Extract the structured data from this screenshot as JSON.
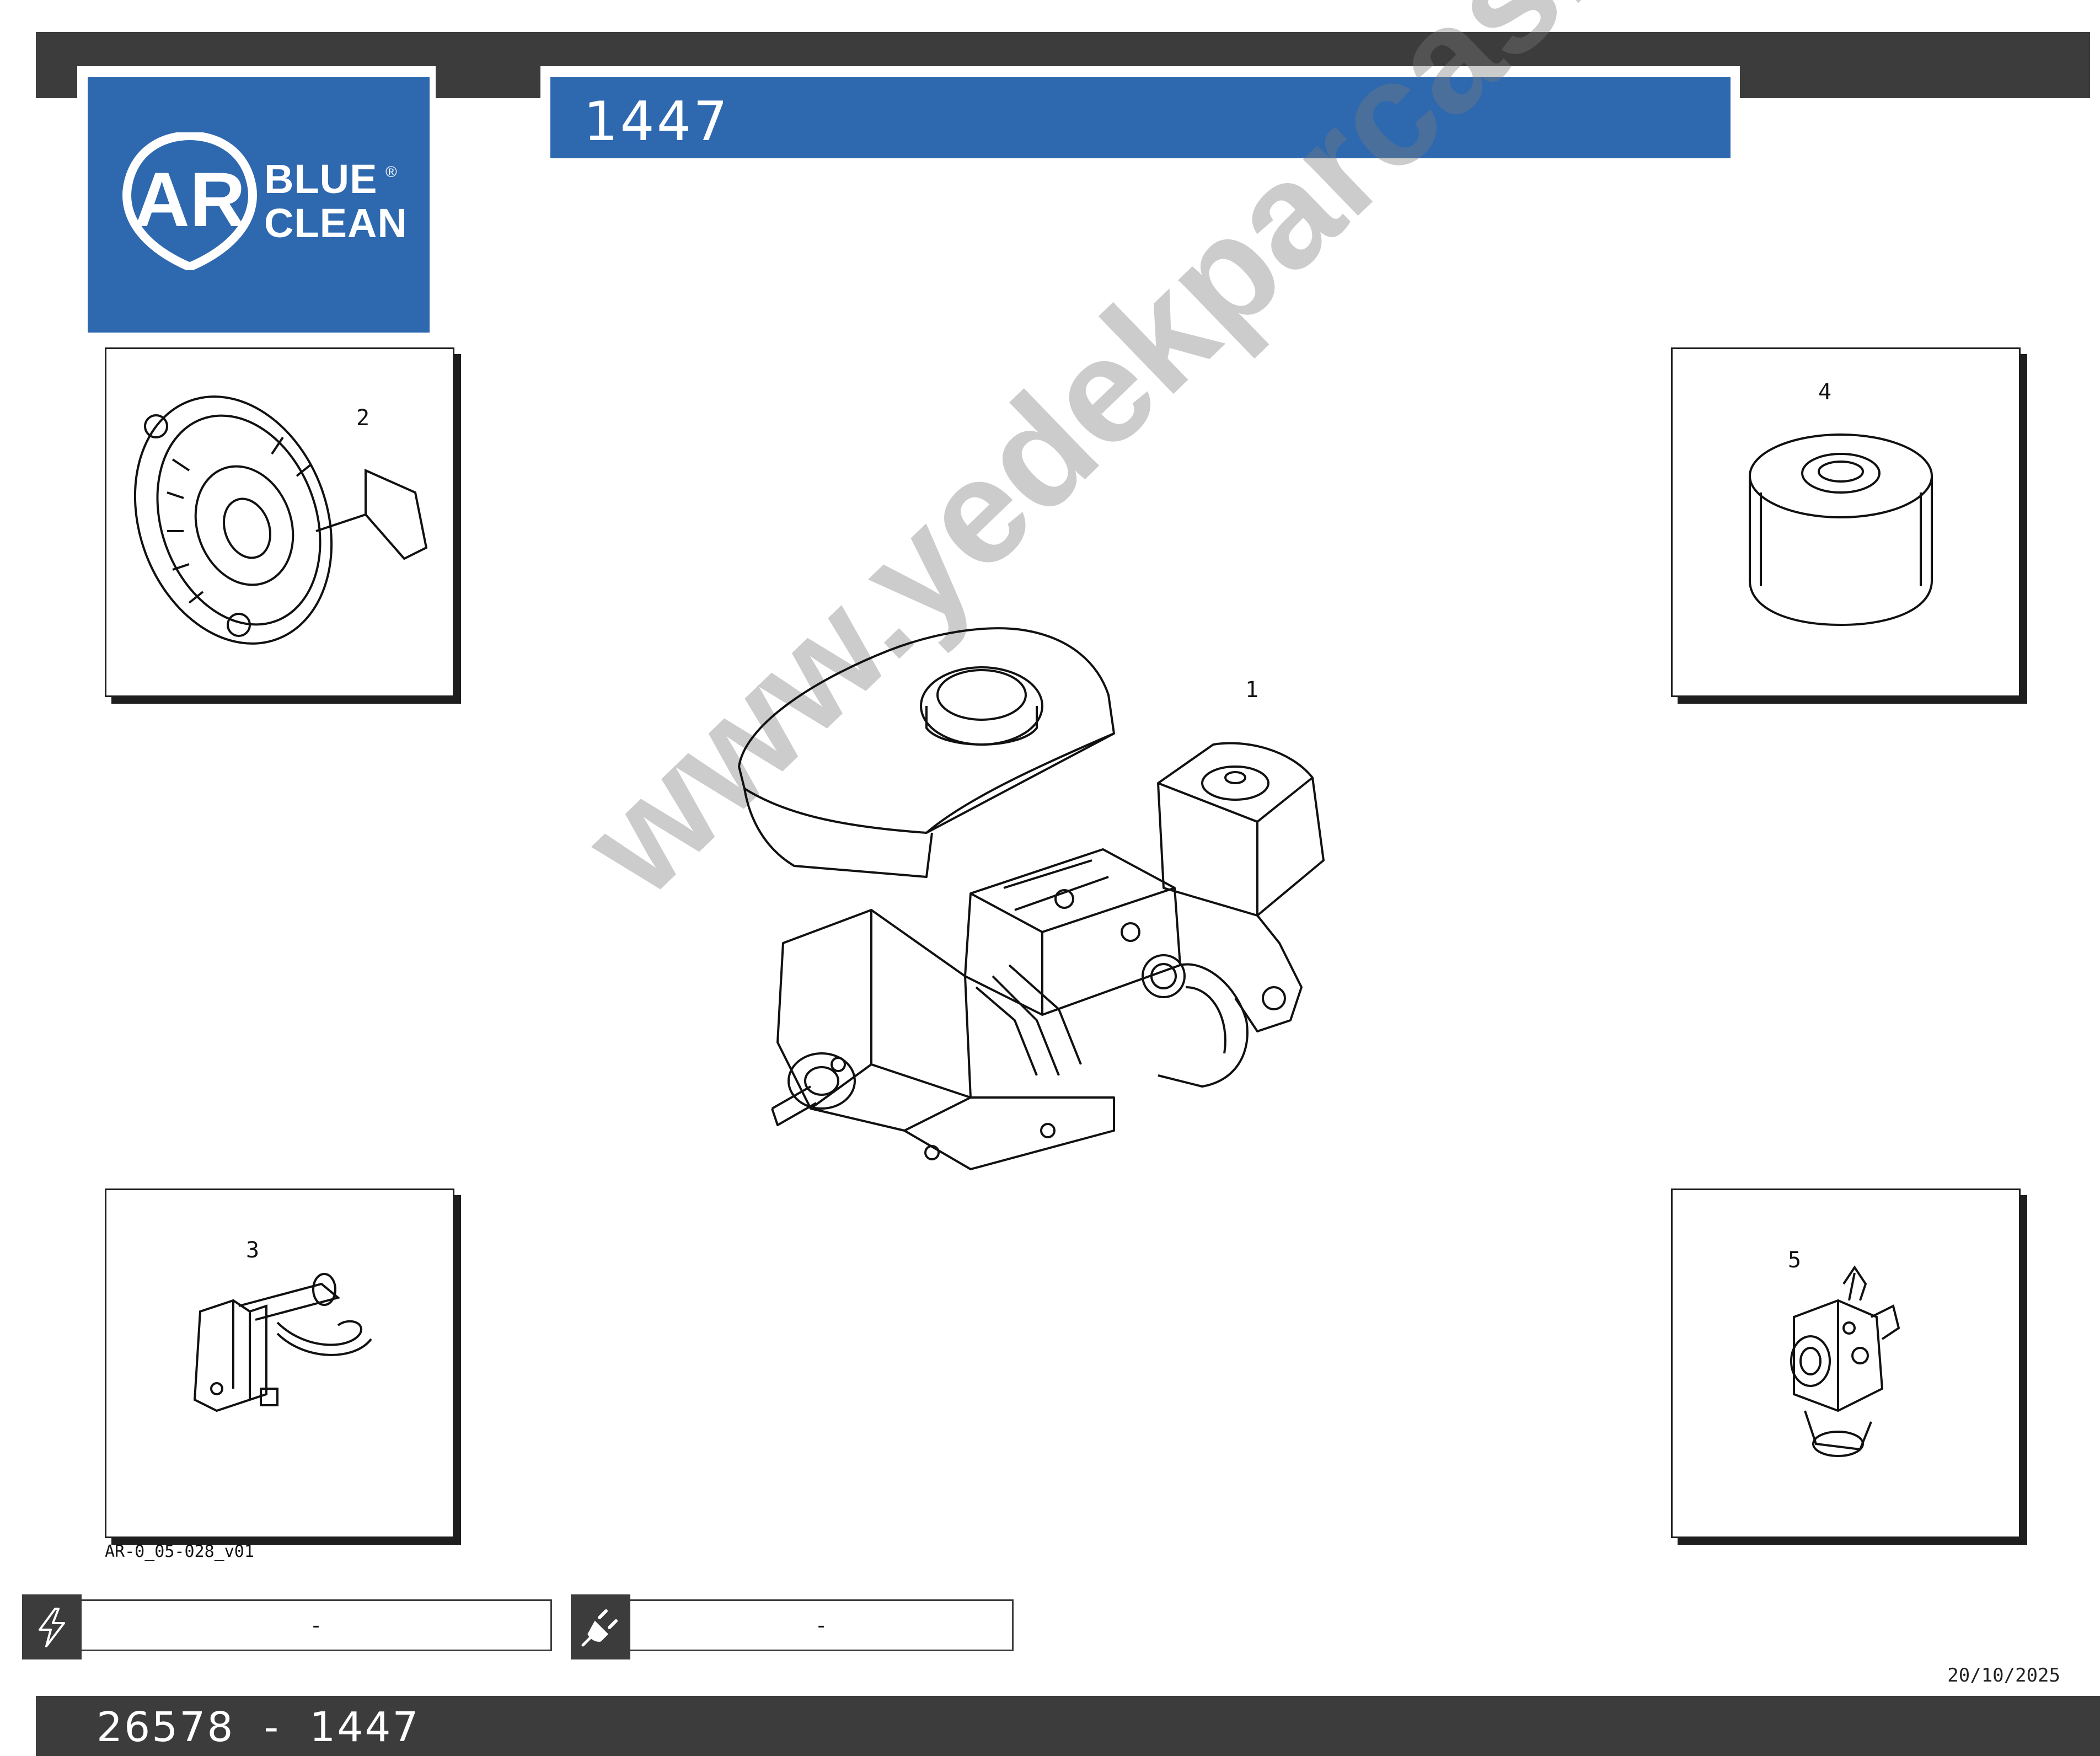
{
  "header": {
    "logo_line1": "BLUE",
    "logo_line2": "CLEAN",
    "logo_mark": "AR",
    "logo_registered": "®",
    "title": "1447"
  },
  "callouts": {
    "main_engine": "1",
    "recoil_starter": "2",
    "fuel_valve": "3",
    "air_filter": "4",
    "carburetor": "5"
  },
  "drawing_ref": "AR-0_05-028_v01",
  "fields": {
    "electrical_value": "-",
    "electrical_icon": "lightning-icon",
    "plug_value": "-",
    "plug_icon": "plug-icon"
  },
  "date": "20/10/2025",
  "footer": {
    "text": "26578  -  1447"
  },
  "colors": {
    "brand_blue": "#2e69b0",
    "bar_gray": "#3c3c3c"
  }
}
